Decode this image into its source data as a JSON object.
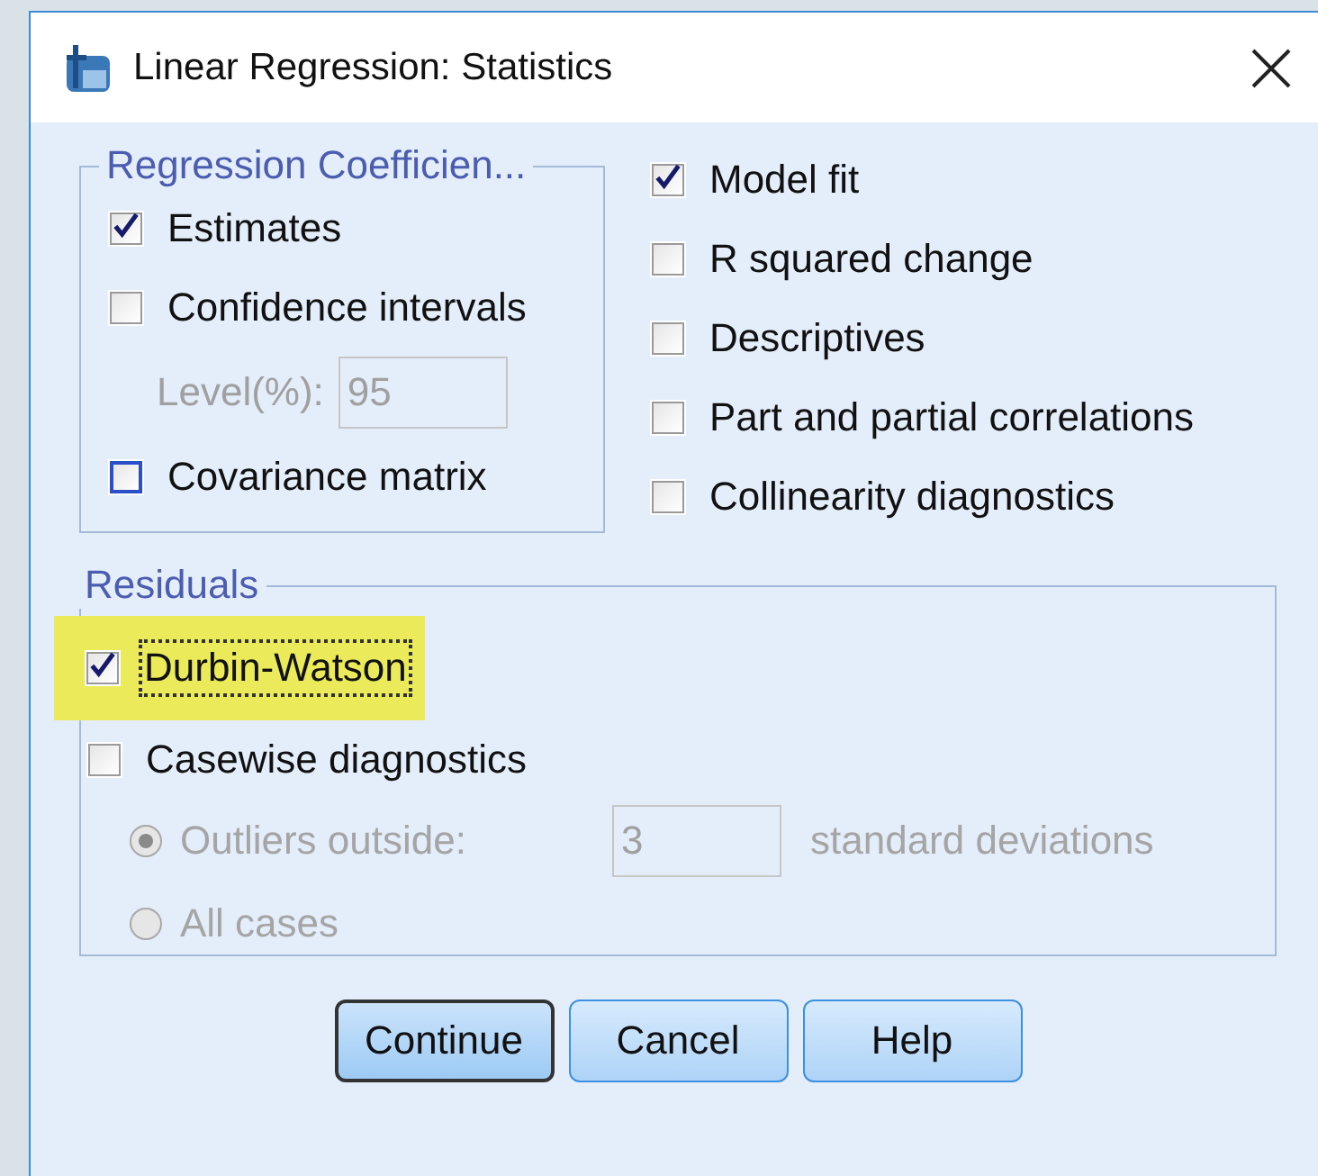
{
  "window": {
    "title": "Linear Regression: Statistics"
  },
  "coefficients": {
    "title": "Regression Coefficien...",
    "items": [
      {
        "kind": "checkbox",
        "label": "Estimates",
        "checked": true,
        "hovered": false
      },
      {
        "kind": "checkbox",
        "label": "Confidence intervals",
        "checked": false,
        "hovered": false
      },
      {
        "kind": "field",
        "label": "Level(%):",
        "value": "95",
        "disabled": true
      },
      {
        "kind": "checkbox",
        "label": "Covariance matrix",
        "checked": false,
        "hovered": true
      }
    ]
  },
  "options": [
    {
      "label": "Model fit",
      "checked": true
    },
    {
      "label": "R squared change",
      "checked": false
    },
    {
      "label": "Descriptives",
      "checked": false
    },
    {
      "label": "Part and partial correlations",
      "checked": false
    },
    {
      "label": "Collinearity diagnostics",
      "checked": false
    }
  ],
  "residuals": {
    "title": "Residuals",
    "items": [
      {
        "kind": "checkbox",
        "label": "Durbin-Watson",
        "checked": true,
        "focused": true,
        "highlighted": true
      },
      {
        "kind": "checkbox",
        "label": "Casewise diagnostics",
        "checked": false,
        "focused": false,
        "highlighted": false
      },
      {
        "kind": "radio",
        "label": "Outliers outside:",
        "selected": true,
        "disabled": true,
        "value": "3",
        "suffix": "standard deviations"
      },
      {
        "kind": "radio",
        "label": "All cases",
        "selected": false,
        "disabled": true
      }
    ]
  },
  "buttons": [
    {
      "label": "Continue",
      "default": true
    },
    {
      "label": "Cancel",
      "default": false
    },
    {
      "label": "Help",
      "default": false
    }
  ]
}
